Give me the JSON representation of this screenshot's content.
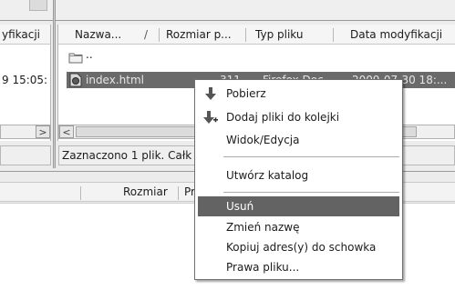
{
  "left_panel": {
    "header_fragment": "yfikacji",
    "row_fragment": "9 15:05:",
    "scroll_right_glyph": ">",
    "bottom_fragment": "Rozmiar",
    "bottom_fragment2": "Pr"
  },
  "file_list": {
    "columns": [
      {
        "label": "Nazwa...",
        "sort_indicator": "/"
      },
      {
        "label": "Rozmiar p..."
      },
      {
        "label": "Typ pliku"
      },
      {
        "label": "Data modyfikacji"
      }
    ],
    "rows": [
      {
        "name": "..",
        "size": "",
        "type": "",
        "date": "",
        "icon": "folder-icon",
        "selected": false
      },
      {
        "name": "index.html",
        "size": "311",
        "type": "Firefox Doc...",
        "date": "2009-07-30 18:...",
        "icon": "html-file-icon",
        "selected": true
      }
    ],
    "scroll_left_glyph": "<"
  },
  "status_bar": {
    "text": "Zaznaczono 1 plik. Całk"
  },
  "context_menu": {
    "items": [
      {
        "label": "Pobierz",
        "icon": "download-arrow-icon",
        "highlighted": false
      },
      {
        "label": "Dodaj pliki do kolejki",
        "icon": "add-to-queue-icon",
        "highlighted": false
      },
      {
        "label": "Widok/Edycja",
        "icon": "",
        "highlighted": false
      },
      {
        "label": "Utwórz katalog",
        "icon": "",
        "highlighted": false
      },
      {
        "label": "Usuń",
        "icon": "",
        "highlighted": true
      },
      {
        "label": "Zmień nazwę",
        "icon": "",
        "highlighted": false
      },
      {
        "label": "Kopiuj adres(y) do schowka",
        "icon": "",
        "highlighted": false
      },
      {
        "label": "Prawa pliku...",
        "icon": "",
        "highlighted": false
      }
    ]
  },
  "colors": {
    "selection": "#6a6a6a",
    "menu_highlight": "#636363",
    "window_background": "#ececec"
  }
}
